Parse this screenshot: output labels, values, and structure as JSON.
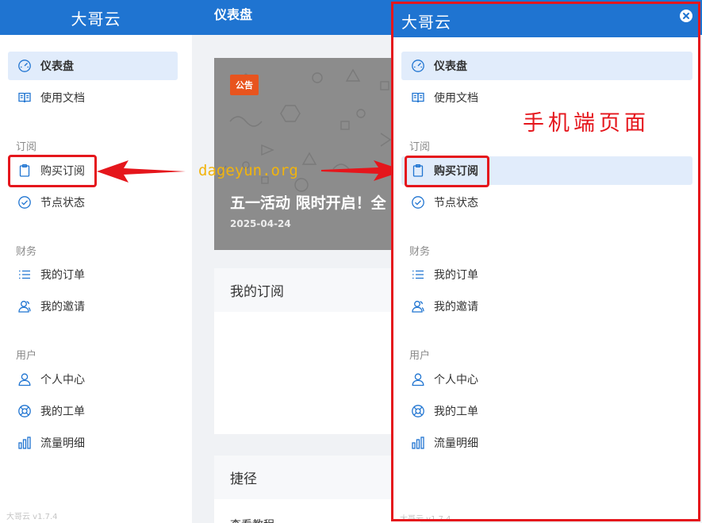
{
  "app": {
    "brand": "大哥云",
    "version": "大哥云 v1.7.4"
  },
  "sidebar": {
    "items": [
      {
        "label": "仪表盘",
        "icon": "dashboard-icon"
      },
      {
        "label": "使用文档",
        "icon": "book-icon"
      },
      {
        "label": "购买订阅",
        "icon": "clipboard-icon"
      },
      {
        "label": "节点状态",
        "icon": "check-circle-icon"
      },
      {
        "label": "我的订单",
        "icon": "list-icon"
      },
      {
        "label": "我的邀请",
        "icon": "users-icon"
      },
      {
        "label": "个人中心",
        "icon": "user-icon"
      },
      {
        "label": "我的工单",
        "icon": "lifebuoy-icon"
      },
      {
        "label": "流量明细",
        "icon": "bar-chart-icon"
      }
    ],
    "groups": [
      "订阅",
      "财务",
      "用户"
    ]
  },
  "topbar": {
    "title": "仪表盘"
  },
  "notice": {
    "badge": "公告",
    "title": "五一活动 限时开启！全",
    "date": "2025-04-24"
  },
  "cards": {
    "subscription_title": "我的订阅",
    "shortcut_title": "捷径",
    "shortcut_item": "查看教程"
  },
  "annotation": {
    "watermark": "dageyun.org",
    "mobile_label": "手机端页面"
  },
  "colors": {
    "primary": "#1f74d1",
    "active_bg": "#e1ecfb",
    "highlight": "#e5161c",
    "badge": "#e8541e",
    "watermark": "#f2b40c"
  }
}
